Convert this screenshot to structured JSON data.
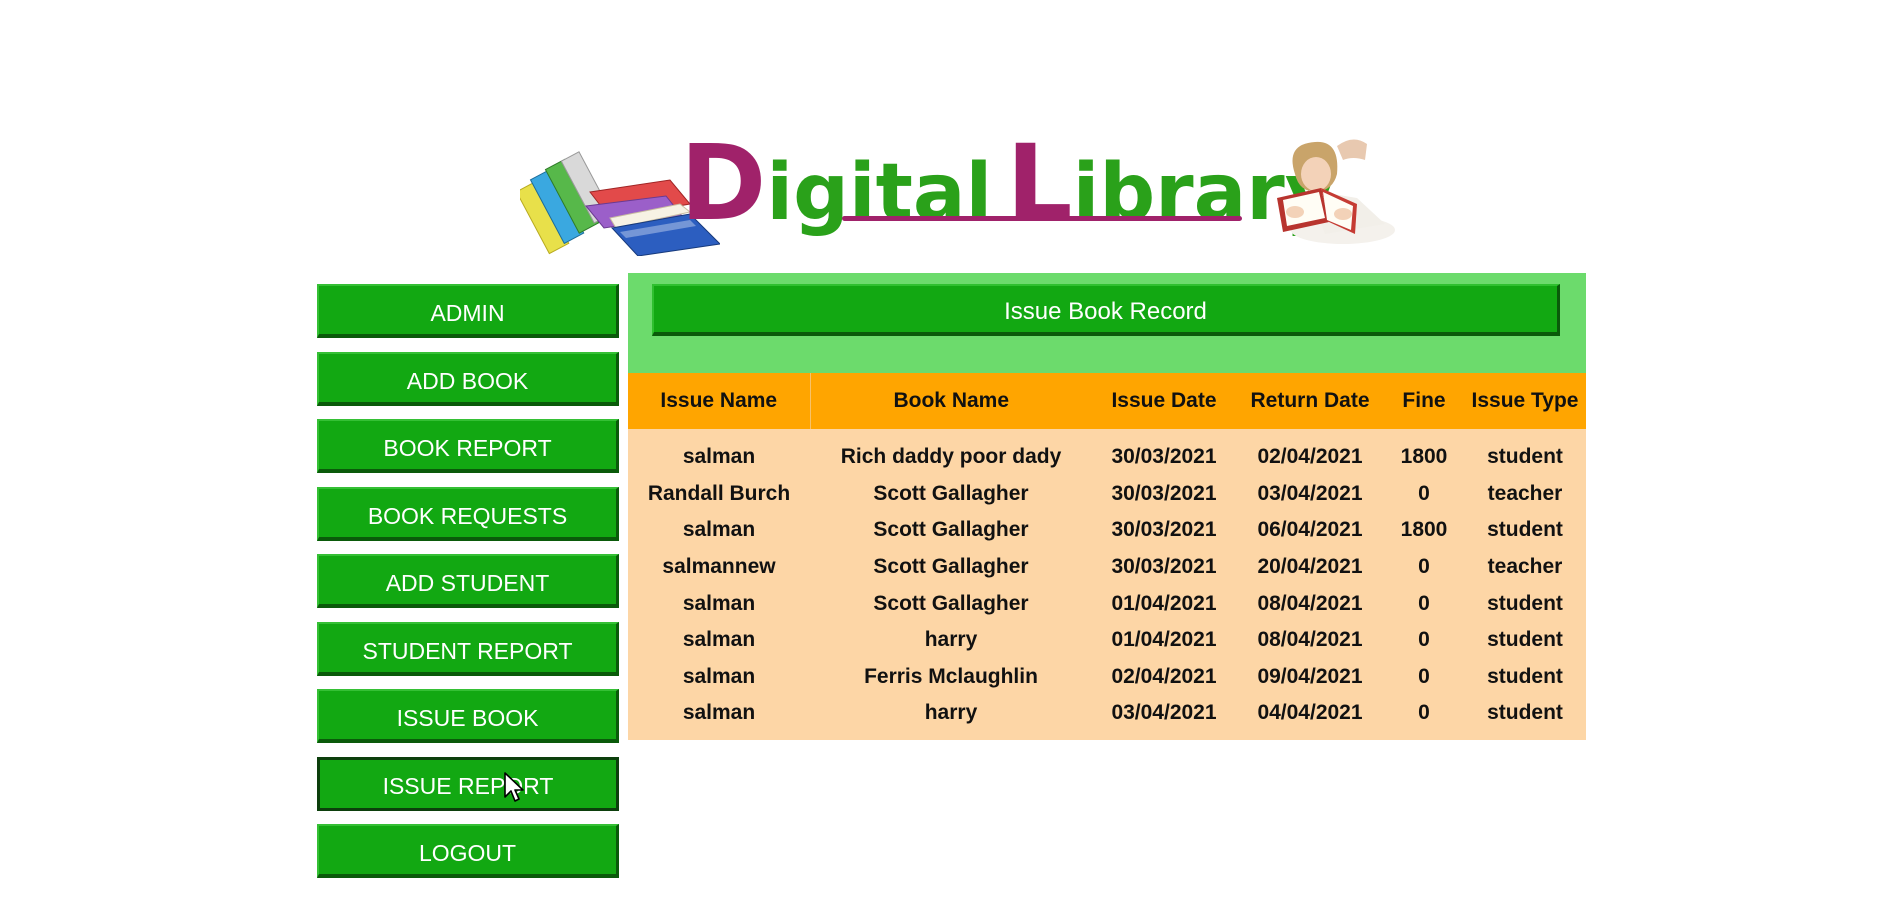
{
  "logo": {
    "text_parts": [
      "D",
      "igital",
      "L",
      "ibrary"
    ]
  },
  "sidebar": {
    "items": [
      {
        "label": "ADMIN"
      },
      {
        "label": "ADD BOOK"
      },
      {
        "label": "BOOK REPORT"
      },
      {
        "label": "BOOK REQUESTS"
      },
      {
        "label": "ADD STUDENT"
      },
      {
        "label": "STUDENT REPORT"
      },
      {
        "label": "ISSUE BOOK"
      },
      {
        "label": "ISSUE REPORT",
        "active": true
      },
      {
        "label": "LOGOUT"
      }
    ]
  },
  "main": {
    "title": "Issue Book Record",
    "table": {
      "columns": [
        "Issue Name",
        "Book Name",
        "Issue Date",
        "Return Date",
        "Fine",
        "Issue Type"
      ],
      "rows": [
        [
          "salman",
          "Rich daddy poor dady",
          "30/03/2021",
          "02/04/2021",
          "1800",
          "student"
        ],
        [
          "Randall Burch",
          "Scott Gallagher",
          "30/03/2021",
          "03/04/2021",
          "0",
          "teacher"
        ],
        [
          "salman",
          "Scott Gallagher",
          "30/03/2021",
          "06/04/2021",
          "1800",
          "student"
        ],
        [
          "salmannew",
          "Scott Gallagher",
          "30/03/2021",
          "20/04/2021",
          "0",
          "teacher"
        ],
        [
          "salman",
          "Scott Gallagher",
          "01/04/2021",
          "08/04/2021",
          "0",
          "student"
        ],
        [
          "salman",
          "harry",
          "01/04/2021",
          "08/04/2021",
          "0",
          "student"
        ],
        [
          "salman",
          "Ferris Mclaughlin",
          "02/04/2021",
          "09/04/2021",
          "0",
          "student"
        ],
        [
          "salman",
          "harry",
          "03/04/2021",
          "04/04/2021",
          "0",
          "student"
        ]
      ]
    }
  },
  "colors": {
    "button_green": "#12a812",
    "panel_green": "#6cdb6c",
    "header_orange": "#ffa500",
    "row_peach": "#fdd6a6",
    "logo_magenta": "#a0226a",
    "logo_green": "#2aa11a"
  },
  "icons": {
    "logo_left": "stack-of-books-icon",
    "logo_right": "girl-reading-book-icon",
    "pointer": "mouse-cursor-icon"
  }
}
